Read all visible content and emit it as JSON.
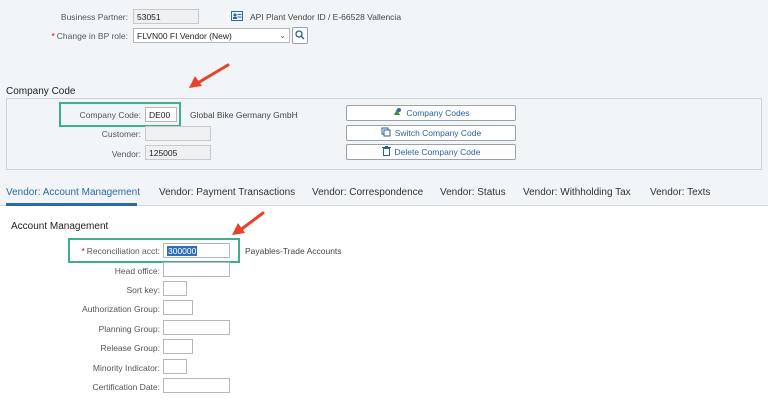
{
  "header": {
    "bp_label": "Business Partner:",
    "bp_value": "53051",
    "bp_description": "API Plant Vendor ID / E-66528 Vallencia",
    "role_label": "Change in BP role:",
    "role_value": "FLVN00 FI Vendor (New)"
  },
  "company_code": {
    "section_title": "Company Code",
    "code_label": "Company Code:",
    "code_value": "DE00",
    "code_description": "Global Bike Germany GmbH",
    "customer_label": "Customer:",
    "customer_value": "",
    "vendor_label": "Vendor:",
    "vendor_value": "125005",
    "buttons": {
      "company_codes": "Company Codes",
      "switch_company_code": "Switch Company Code",
      "delete_company_code": "Delete Company Code"
    }
  },
  "tabs": [
    {
      "label": "Vendor: Account Management"
    },
    {
      "label": "Vendor: Payment Transactions"
    },
    {
      "label": "Vendor: Correspondence"
    },
    {
      "label": "Vendor: Status"
    },
    {
      "label": "Vendor: Withholding Tax"
    },
    {
      "label": "Vendor: Texts"
    }
  ],
  "account_management": {
    "section_title": "Account Management",
    "recon_label": "Reconciliation acct:",
    "recon_value": "300000",
    "recon_description": "Payables-Trade Accounts",
    "fields": [
      {
        "label": "Head office:",
        "value": ""
      },
      {
        "label": "Sort key:",
        "value": ""
      },
      {
        "label": "Authorization Group:",
        "value": ""
      },
      {
        "label": "Planning Group:",
        "value": ""
      },
      {
        "label": "Release Group:",
        "value": ""
      },
      {
        "label": "Minority Indicator:",
        "value": ""
      },
      {
        "label": "Certification Date:",
        "value": ""
      }
    ]
  },
  "colors": {
    "highlight": "#3fae8c",
    "arrow": "#e8412c",
    "active_tab": "#2a6aa8"
  }
}
